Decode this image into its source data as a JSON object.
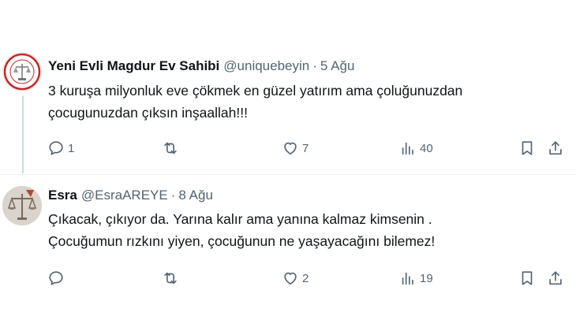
{
  "tweets": [
    {
      "display_name": "Yeni Evli Magdur Ev Sahibi",
      "handle": "@uniquebeyin",
      "separator": "·",
      "date": "5 Ağu",
      "lines": [
        "3 kuruşa milyonluk eve çökmek en güzel yatırım ama çoluğunuzdan",
        "çocugunuzdan çıksın inşaallah!!!"
      ],
      "reply_count": "1",
      "retweet_count": "",
      "like_count": "7",
      "view_count": "40",
      "avatar_colors": {
        "ring": "#c62828",
        "text": "#b71c1c"
      }
    },
    {
      "display_name": "Esra",
      "handle": "@EsraAREYE",
      "separator": "·",
      "date": "8 Ağu",
      "lines": [
        "Çıkacak, çıkıyor da. Yarına kalır ama yanına kalmaz kimsenin .",
        "Çocuğumun rızkını yiyen, çocuğunun ne yaşayacağını bilemez!"
      ],
      "reply_count": "",
      "retweet_count": "",
      "like_count": "2",
      "view_count": "19",
      "avatar_colors": {
        "bg": "#d9d4cc",
        "scale": "#7a6a5a",
        "accent": "#b5452e"
      }
    }
  ],
  "icons": [
    "reply-icon",
    "retweet-icon",
    "like-icon",
    "views-icon",
    "bookmark-icon",
    "share-icon"
  ]
}
